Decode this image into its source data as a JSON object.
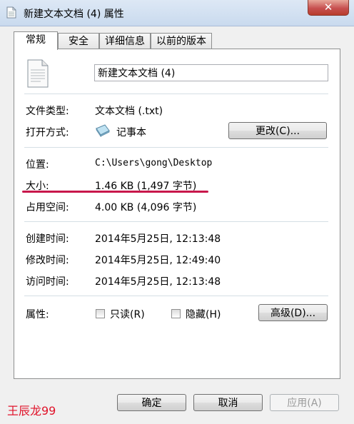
{
  "window": {
    "title": "新建文本文档 (4) 属性",
    "close_label": "✕"
  },
  "tabs": [
    {
      "label": "常规",
      "active": true
    },
    {
      "label": "安全",
      "active": false
    },
    {
      "label": "详细信息",
      "active": false
    },
    {
      "label": "以前的版本",
      "active": false
    }
  ],
  "general": {
    "file_name": "新建文本文档 (4)",
    "file_type_label": "文件类型:",
    "file_type_value": "文本文档 (.txt)",
    "open_with_label": "打开方式:",
    "open_with_value": "记事本",
    "change_button": "更改(C)...",
    "location_label": "位置:",
    "location_value": "C:\\Users\\gong\\Desktop",
    "size_label": "大小:",
    "size_value": "1.46 KB (1,497 字节)",
    "disk_size_label": "占用空间:",
    "disk_size_value": "4.00 KB (4,096 字节)",
    "created_label": "创建时间:",
    "created_value": "2014年5月25日, 12:13:48",
    "modified_label": "修改时间:",
    "modified_value": "2014年5月25日, 12:49:40",
    "accessed_label": "访问时间:",
    "accessed_value": "2014年5月25日, 12:13:48",
    "attributes_label": "属性:",
    "readonly_label": "只读(R)",
    "readonly_checked": false,
    "hidden_label": "隐藏(H)",
    "hidden_checked": false,
    "advanced_button": "高级(D)..."
  },
  "footer": {
    "ok_button": "确定",
    "cancel_button": "取消",
    "apply_button": "应用(A)"
  },
  "overlay": {
    "watermark": "王辰龙99",
    "annotation_color": "#c8174b"
  }
}
